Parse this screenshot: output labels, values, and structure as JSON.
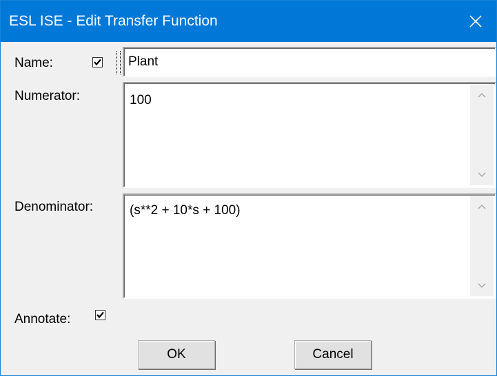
{
  "window": {
    "title": "ESL ISE - Edit Transfer Function"
  },
  "form": {
    "name_label": "Name:",
    "name_checked": true,
    "name_value": "Plant",
    "numerator_label": "Numerator:",
    "numerator_value": "100",
    "denominator_label": "Denominator:",
    "denominator_value": "(s**2 + 10*s + 100)",
    "annotate_label": "Annotate:",
    "annotate_checked": true
  },
  "buttons": {
    "ok": "OK",
    "cancel": "Cancel"
  },
  "colors": {
    "titlebar": "#0078d7",
    "dialog_bg": "#f0f0f0"
  }
}
